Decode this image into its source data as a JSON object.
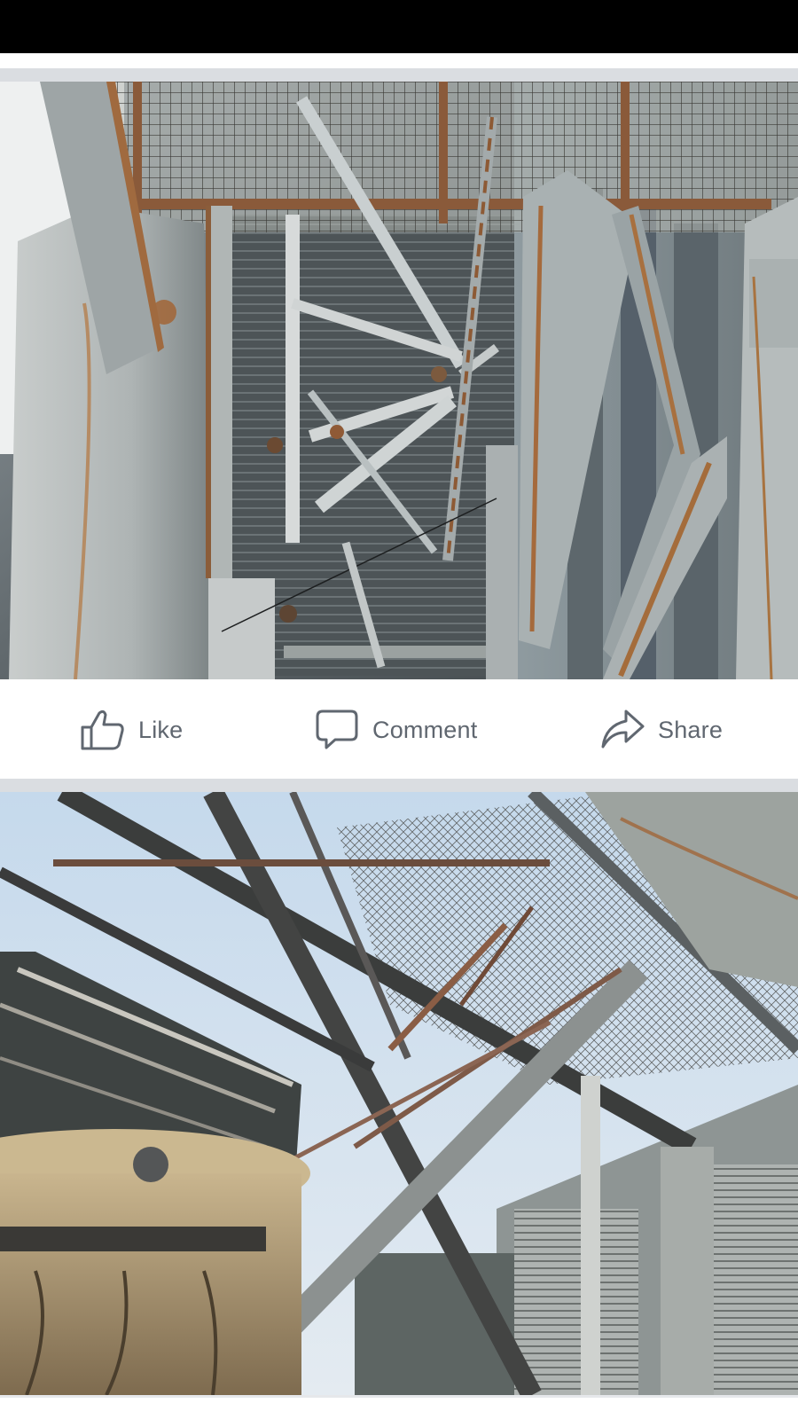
{
  "actions": {
    "like_label": "Like",
    "comment_label": "Comment",
    "share_label": "Share"
  },
  "icons": {
    "like": "thumbs-up-icon",
    "comment": "speech-bubble-icon",
    "share": "share-arrow-icon"
  },
  "colors": {
    "action_text": "#606770",
    "separator": "#dadde1",
    "status_bar": "#000000"
  }
}
